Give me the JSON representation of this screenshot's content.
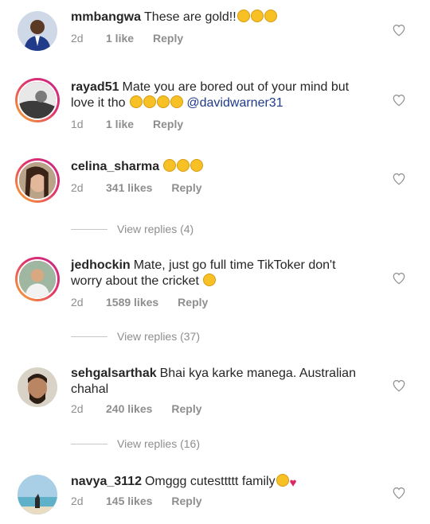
{
  "comments": [
    {
      "username": "mmbangwa",
      "text": "These are gold!!",
      "emojis": 3,
      "time": "2d",
      "likes": "1 like",
      "reply": "Reply"
    },
    {
      "username": "rayad51",
      "text": "Mate you are bored out of your mind but love it tho",
      "emojis": 4,
      "mention": "@davidwarner31",
      "time": "1d",
      "likes": "1 like",
      "reply": "Reply"
    },
    {
      "username": "celina_sharma",
      "text": "",
      "emojis": 3,
      "time": "2d",
      "likes": "341 likes",
      "reply": "Reply",
      "view_replies": "View replies (4)"
    },
    {
      "username": "jedhockin",
      "text": "Mate, just go full time TikToker don't worry about the cricket",
      "emojis": 1,
      "time": "2d",
      "likes": "1589 likes",
      "reply": "Reply",
      "view_replies": "View replies (37)"
    },
    {
      "username": "sehgalsarthak",
      "text": "Bhai kya karke manega. Australian chahal",
      "time": "2d",
      "likes": "240 likes",
      "reply": "Reply",
      "view_replies": "View replies (16)"
    },
    {
      "username": "navya_3112",
      "text": "Omggg cutesttttt family",
      "emojis": 1,
      "time": "2d",
      "likes": "145 likes",
      "reply": "Reply"
    }
  ],
  "icons": {
    "like": "heart-outline-icon",
    "emoji": "laughing-emoji-icon"
  }
}
